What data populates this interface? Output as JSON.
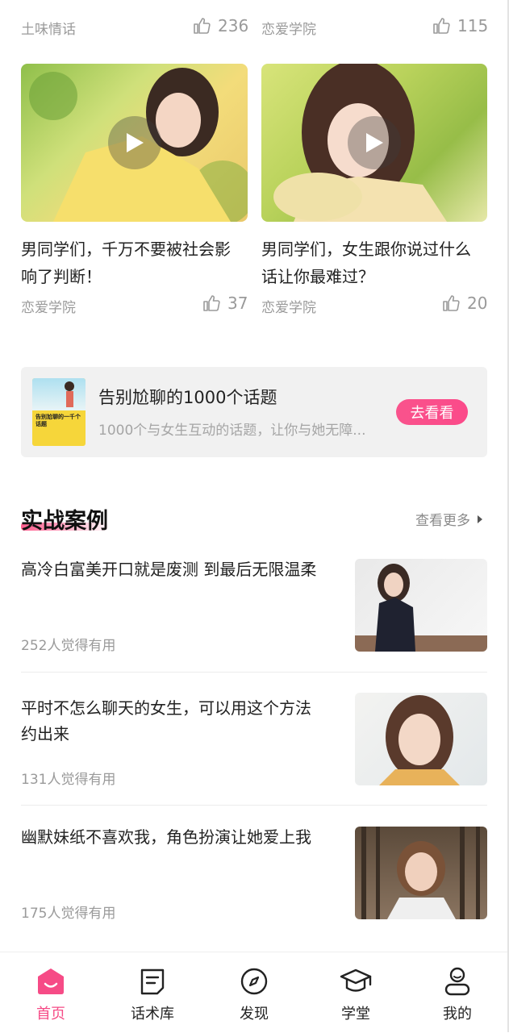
{
  "top_row": {
    "left": {
      "source": "土味情话",
      "likes": "236"
    },
    "right": {
      "source": "恋爱学院",
      "likes": "115"
    }
  },
  "video_cards": [
    {
      "title": "男同学们，千万不要被社会影响了判断！",
      "title_line1": "男同学们，千万不要被社会影",
      "title_line2": "响了判断！",
      "source": "恋爱学院",
      "likes": "37"
    },
    {
      "title": "男同学们，女生跟你说过什么话让你最难过？",
      "title_line1": "男同学们，女生跟你说过什么",
      "title_line2": "话让你最难过？",
      "source": "恋爱学院",
      "likes": "20"
    }
  ],
  "banner": {
    "book_label": "告别尬聊的一千个话题",
    "title": "告别尬聊的1000个话题",
    "subtitle": "1000个与女生互动的话题，让你与她无障...",
    "button": "去看看"
  },
  "cases_section": {
    "title": "实战案例",
    "more": "查看更多",
    "items": [
      {
        "title": "高冷白富美开口就是废测 到最后无限温柔",
        "meta": "252人觉得有用"
      },
      {
        "title_line1": "平时不怎么聊天的女生，可以用这个方法",
        "title_line2": "约出来",
        "meta": "131人觉得有用"
      },
      {
        "title": "幽默妹纸不喜欢我，角色扮演让她爱上我",
        "meta": "175人觉得有用"
      }
    ]
  },
  "tabs": [
    {
      "label": "首页",
      "icon": "home-icon",
      "active": true
    },
    {
      "label": "话术库",
      "icon": "script-library-icon",
      "active": false
    },
    {
      "label": "发现",
      "icon": "compass-icon",
      "active": false
    },
    {
      "label": "学堂",
      "icon": "graduation-cap-icon",
      "active": false
    },
    {
      "label": "我的",
      "icon": "user-icon",
      "active": false
    }
  ],
  "colors": {
    "accent": "#f64b86",
    "text": "#222222",
    "muted": "#9a9a9a"
  }
}
